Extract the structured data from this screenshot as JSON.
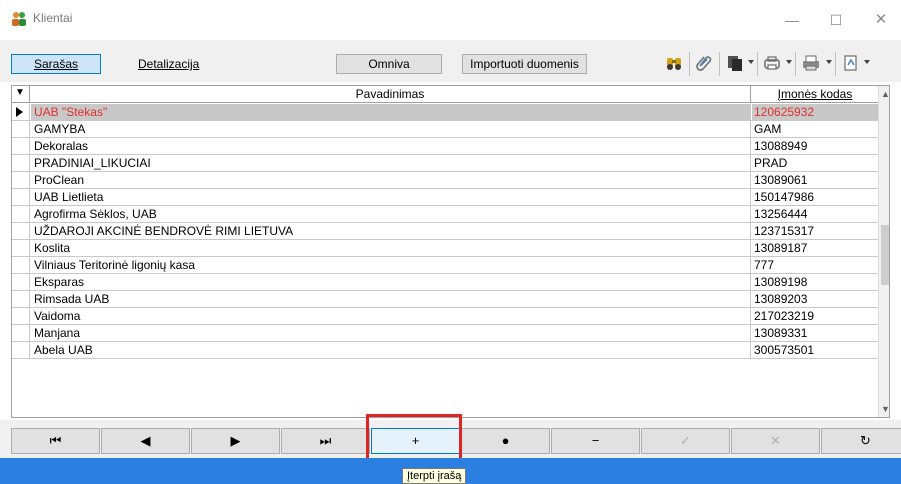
{
  "window": {
    "title": "Klientai",
    "minimize_glyph": "—",
    "maximize_glyph": "☐",
    "close_glyph": "✕"
  },
  "toolbar": {
    "tabs": [
      {
        "label": "Sarašas",
        "active": true
      },
      {
        "label": "Detalizacija",
        "active": false
      }
    ],
    "omniva_label": "Omniva",
    "import_label": "Importuoti duomenis",
    "icons": [
      "find-icon",
      "attach-icon",
      "copy-icon",
      "print-icon",
      "printer-setup-icon",
      "export-icon"
    ]
  },
  "grid": {
    "columns": {
      "indicator_glyph": "▼",
      "name": "Pavadinimas",
      "code": "Įmonės kodas"
    },
    "rows": [
      {
        "name": "UAB \"Stekas\"",
        "code": "120625932",
        "selected": true
      },
      {
        "name": "GAMYBA",
        "code": "GAM"
      },
      {
        "name": "Dekoralas",
        "code": "13088949"
      },
      {
        "name": "PRADINIAI_LIKUCIAI",
        "code": "PRAD"
      },
      {
        "name": "ProClean",
        "code": "13089061"
      },
      {
        "name": "UAB Lietlieta",
        "code": "150147986"
      },
      {
        "name": "Agrofirma Sėklos, UAB",
        "code": "13256444"
      },
      {
        "name": "UŽDAROJI AKCINĖ BENDROVĖ RIMI LIETUVA",
        "code": "123715317"
      },
      {
        "name": "Koslita",
        "code": "13089187"
      },
      {
        "name": "Vilniaus Teritorinė ligonių kasa",
        "code": "777"
      },
      {
        "name": "Eksparas",
        "code": "13089198"
      },
      {
        "name": "Rimsada UAB",
        "code": "13089203"
      },
      {
        "name": "Vaidoma",
        "code": "217023219"
      },
      {
        "name": "Manjana",
        "code": "13089331"
      },
      {
        "name": "Abela UAB",
        "code": "300573501"
      }
    ]
  },
  "navbar": {
    "buttons": [
      {
        "name": "first-record-button",
        "glyph": "⏮",
        "enabled": true
      },
      {
        "name": "prior-record-button",
        "glyph": "◀",
        "enabled": true
      },
      {
        "name": "next-record-button",
        "glyph": "▶",
        "enabled": true
      },
      {
        "name": "last-record-button",
        "glyph": "⏭",
        "enabled": true
      },
      {
        "name": "insert-record-button",
        "glyph": "+",
        "enabled": true
      },
      {
        "name": "edit-record-button",
        "glyph": "●",
        "enabled": true
      },
      {
        "name": "delete-record-button",
        "glyph": "−",
        "enabled": true
      },
      {
        "name": "post-record-button",
        "glyph": "✓",
        "enabled": false
      },
      {
        "name": "cancel-edit-button",
        "glyph": "✕",
        "enabled": false
      },
      {
        "name": "refresh-button",
        "glyph": "↻",
        "enabled": true
      }
    ],
    "tooltip": "Įterpti įrašą"
  },
  "colors": {
    "selected_text": "#e0302a",
    "highlight_border": "#e02424",
    "taskbar": "#2b7fe0"
  }
}
